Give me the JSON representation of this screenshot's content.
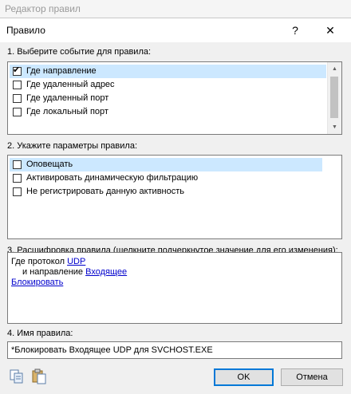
{
  "background_window": {
    "title": "Редактор правил"
  },
  "dialog": {
    "title": "Правило",
    "help_glyph": "?",
    "close_glyph": "✕"
  },
  "section1": {
    "label": "1. Выберите событие для правила:",
    "items": [
      {
        "label": "Где направление",
        "checked": true,
        "selected": true
      },
      {
        "label": "Где удаленный адрес",
        "checked": false,
        "selected": false
      },
      {
        "label": "Где удаленный порт",
        "checked": false,
        "selected": false
      },
      {
        "label": "Где локальный порт",
        "checked": false,
        "selected": false
      }
    ]
  },
  "section2": {
    "label": "2. Укажите параметры правила:",
    "items": [
      {
        "label": "Оповещать",
        "checked": false,
        "selected": true
      },
      {
        "label": "Активировать динамическую фильтрацию",
        "checked": false,
        "selected": false
      },
      {
        "label": "Не регистрировать данную активность",
        "checked": false,
        "selected": false
      }
    ]
  },
  "section3": {
    "label": "3. Расшифровка правила (щелкните подчеркнутое значение для его изменения):",
    "line1_prefix": "Где протокол",
    "line1_link": "UDP",
    "line2_prefix": "и направление",
    "line2_link": "Входящее",
    "line3_link": "Блокировать"
  },
  "section4": {
    "label": "4. Имя правила:",
    "name_value": "*Блокировать Входящее UDP для SVCHOST.EXE"
  },
  "buttons": {
    "ok": "OK",
    "cancel": "Отмена"
  },
  "icons": {
    "copy": "copy-icon",
    "paste": "paste-icon"
  },
  "colors": {
    "selection": "#cce8ff",
    "link": "#0000cc",
    "default_button_border": "#0078d7"
  }
}
